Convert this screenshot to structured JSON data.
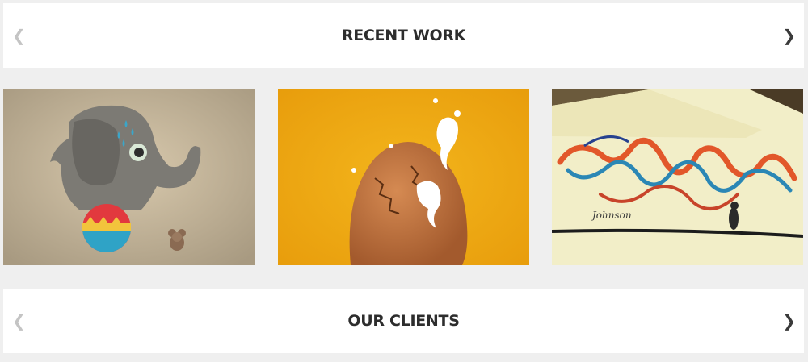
{
  "recent_work": {
    "title": "RECENT WORK",
    "prev_icon": "chevron-left-icon",
    "next_icon": "chevron-right-icon",
    "prev_glyph": "❮",
    "next_glyph": "❯",
    "items": [
      {
        "subject": "elephant-balancing-on-ball-illustration"
      },
      {
        "subject": "cracking-egg-with-milk-splash-photo"
      },
      {
        "subject": "colorful-hand-lettering-on-paper-photo",
        "signature_text": "Johnson"
      }
    ]
  },
  "our_clients": {
    "title": "OUR CLIENTS",
    "prev_glyph": "❮",
    "next_glyph": "❯"
  },
  "colors": {
    "page_bg": "#efefef",
    "panel_bg": "#ffffff",
    "title_text": "#2d2d2d",
    "arrow_inactive": "#c4c4c4",
    "arrow_active": "#3a3a3a"
  }
}
